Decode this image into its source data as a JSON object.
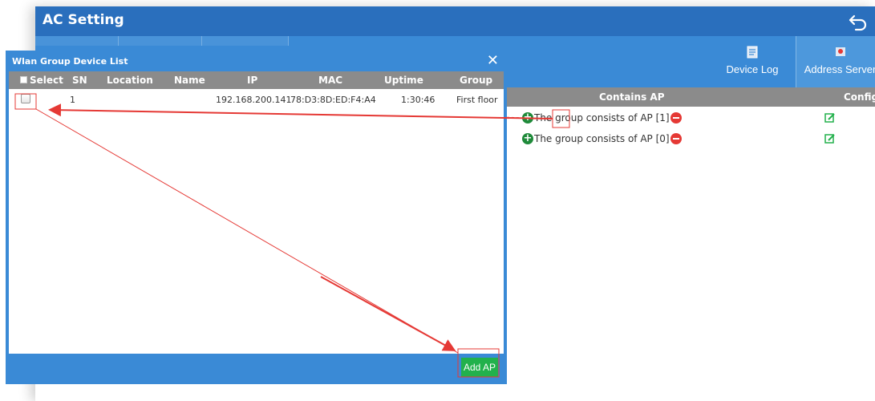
{
  "app": {
    "title": "AC Setting",
    "toolbar": {
      "device_log": "Device Log",
      "address_server": "Address Server"
    },
    "ap_table": {
      "columns": [
        "Contains AP",
        "Config"
      ],
      "rows": [
        {
          "text": "The group consists of AP [1]"
        },
        {
          "text": "The group consists of AP [0]"
        }
      ]
    }
  },
  "modal": {
    "title": "Wlan Group Device List",
    "close_label": "✕",
    "columns": {
      "select": "Select",
      "sn": "SN",
      "location": "Location",
      "name": "Name",
      "ip": "IP",
      "mac": "MAC",
      "uptime": "Uptime",
      "group": "Group"
    },
    "rows": [
      {
        "sn": "1",
        "location": "",
        "name": "",
        "ip": "192.168.200.141",
        "mac": "78:D3:8D:ED:F4:A4",
        "uptime": "1:30:46",
        "group": "First floor"
      }
    ],
    "add_button": "Add AP"
  },
  "icons": {
    "back": "back-arrow-icon",
    "device_log": "document-icon",
    "address_server": "map-pin-icon",
    "add": "plus-circle-icon",
    "remove": "minus-circle-icon",
    "edit": "edit-icon"
  },
  "colors": {
    "header": "#2a6fbd",
    "toolbar": "#3a8ad6",
    "table_header": "#8b8b8b",
    "add_button": "#22b14c",
    "annotation": "#e53935"
  }
}
